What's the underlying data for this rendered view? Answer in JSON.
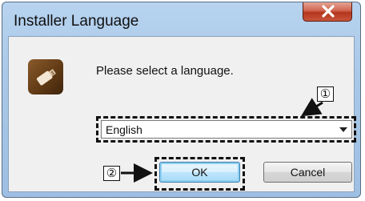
{
  "window": {
    "title": "Installer Language",
    "close_glyph": "✖"
  },
  "dialog": {
    "prompt": "Please select a language.",
    "language_select": {
      "selected": "English"
    },
    "buttons": {
      "ok": "OK",
      "cancel": "Cancel"
    }
  },
  "callouts": {
    "first": "①",
    "second": "②"
  },
  "icons": {
    "app": "usb-drive-icon",
    "close": "close-icon",
    "dropdown": "chevron-down-icon"
  },
  "colors": {
    "titlebar": "#a9c8e8",
    "close_button": "#c8553b",
    "client_bg": "#f0f0f0",
    "ok_focus": "#3c7fb1"
  }
}
